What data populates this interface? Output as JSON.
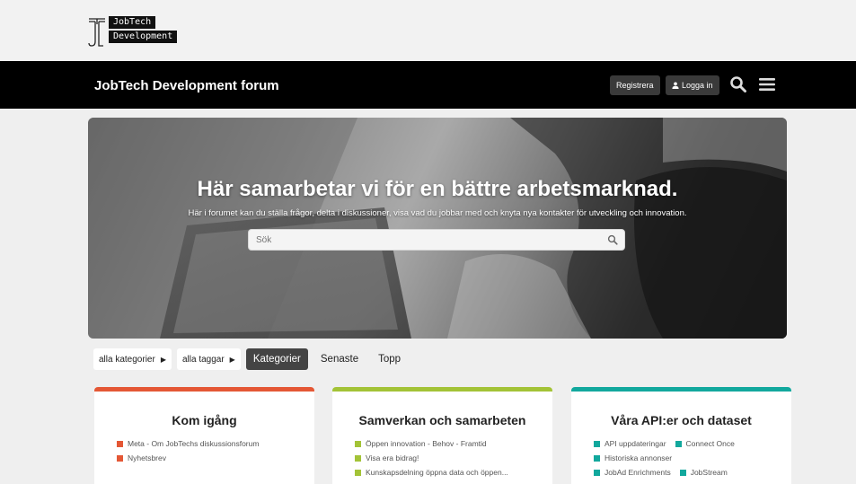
{
  "logo": {
    "line1": "JobTech",
    "line2": "Development"
  },
  "header": {
    "title": "JobTech Development forum",
    "register_label": "Registrera",
    "login_label": "Logga in",
    "search_icon": "search-icon",
    "menu_icon": "hamburger-menu-icon",
    "background": "#000000"
  },
  "hero": {
    "title": "Här samarbetar vi för en bättre arbetsmarknad.",
    "subtitle": "Här i forumet kan du ställa frågor, delta i diskussioner, visa vad du jobbar med och knyta nya kontakter för utveckling och innovation.",
    "search_placeholder": "Sök"
  },
  "nav": {
    "categories_dropdown": "alla kategorier",
    "tags_dropdown": "alla taggar",
    "tabs": [
      {
        "label": "Kategorier",
        "active": true
      },
      {
        "label": "Senaste",
        "active": false
      },
      {
        "label": "Topp",
        "active": false
      }
    ]
  },
  "categories": [
    {
      "title": "Kom igång",
      "color": "#e45735",
      "subcategories": [
        {
          "label": "Meta - Om JobTechs diskussionsforum",
          "color": "#e45735"
        },
        {
          "label": "Nyhetsbrev",
          "color": "#e45735"
        }
      ]
    },
    {
      "title": "Samverkan och samarbeten",
      "color": "#a3c337",
      "subcategories": [
        {
          "label": "Öppen innovation - Behov - Framtid",
          "color": "#a3c337"
        },
        {
          "label": "Visa era bidrag!",
          "color": "#a3c337"
        },
        {
          "label": "Kunskapsdelning öppna data och öppen...",
          "color": "#a3c337"
        }
      ]
    },
    {
      "title": "Våra API:er och dataset",
      "color": "#12a89d",
      "subcategories": [
        {
          "label": "API uppdateringar",
          "color": "#12a89d"
        },
        {
          "label": "Connect Once",
          "color": "#12a89d"
        },
        {
          "label": "Historiska annonser",
          "color": "#12a89d"
        },
        {
          "label": "JobAd Enrichments",
          "color": "#12a89d"
        },
        {
          "label": "JobStream",
          "color": "#12a89d"
        }
      ]
    }
  ]
}
